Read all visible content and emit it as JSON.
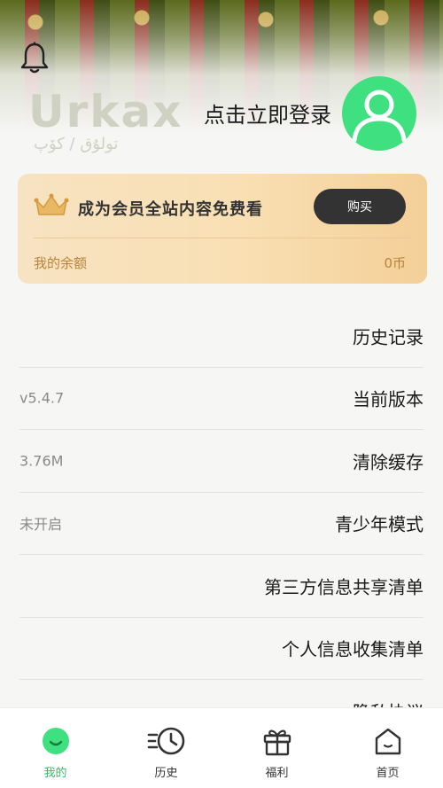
{
  "header": {
    "logo_text": "Urkax",
    "logo_subtitle": "تولۇق / كۆپ",
    "login_prompt": "点击立即登录"
  },
  "vip": {
    "title": "成为会员全站内容免费看",
    "buy_label": "购买",
    "balance_label": "我的余额",
    "balance_value": "0币"
  },
  "menu": {
    "items": [
      {
        "label": "历史记录",
        "value": ""
      },
      {
        "label": "当前版本",
        "value": "v5.4.7"
      },
      {
        "label": "清除缓存",
        "value": "3.76M"
      },
      {
        "label": "青少年模式",
        "value": "未开启"
      },
      {
        "label": "第三方信息共享清单",
        "value": ""
      },
      {
        "label": "个人信息收集清单",
        "value": ""
      },
      {
        "label": "隐私协议",
        "value": ""
      }
    ]
  },
  "tabbar": {
    "tabs": [
      {
        "label": "我的",
        "icon": "profile-icon",
        "active": true
      },
      {
        "label": "历史",
        "icon": "history-clock-icon",
        "active": false
      },
      {
        "label": "福利",
        "icon": "gift-icon",
        "active": false
      },
      {
        "label": "首页",
        "icon": "home-icon",
        "active": false
      }
    ]
  },
  "colors": {
    "accent_green": "#3ee07f",
    "active_tab": "#2fbf63",
    "vip_gold": "#b8843a",
    "buy_button": "#333333"
  }
}
